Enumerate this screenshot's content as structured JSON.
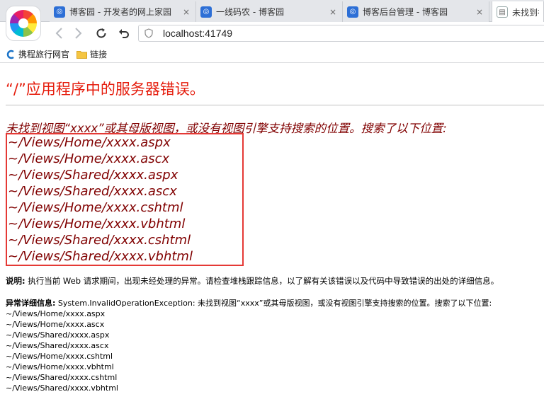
{
  "tabs": [
    {
      "title": "博客园 - 开发者的网上家园",
      "favicon": "cnblogs-icon",
      "active": false
    },
    {
      "title": "一线码农 - 博客园",
      "favicon": "cnblogs-icon",
      "active": false
    },
    {
      "title": "博客后台管理 - 博客园",
      "favicon": "cnblogs-icon",
      "active": false
    },
    {
      "title": "未找到视",
      "favicon": "page-icon",
      "active": true
    }
  ],
  "tab_close_glyph": "×",
  "address": {
    "url": "localhost:41749"
  },
  "bookmarks": [
    {
      "label": "携程旅行网官",
      "icon": "ctrip-icon"
    },
    {
      "label": "链接",
      "icon": "folder-icon"
    }
  ],
  "page": {
    "title": "“/”应用程序中的服务器错误。",
    "error_message": "未找到视图“xxxx”或其母版视图，或没有视图引擎支持搜索的位置。搜索了以下位置:",
    "locations": [
      "~/Views/Home/xxxx.aspx",
      "~/Views/Home/xxxx.ascx",
      "~/Views/Shared/xxxx.aspx",
      "~/Views/Shared/xxxx.ascx",
      "~/Views/Home/xxxx.cshtml",
      "~/Views/Home/xxxx.vbhtml",
      "~/Views/Shared/xxxx.cshtml",
      "~/Views/Shared/xxxx.vbhtml"
    ],
    "description_label": "说明:",
    "description_text": " 执行当前 Web 请求期间，出现未经处理的异常。请检查堆栈跟踪信息，以了解有关该错误以及代码中导致错误的出处的详细信息。",
    "details_label": "异常详细信息:",
    "details_text": " System.InvalidOperationException: 未找到视图“xxxx”或其母版视图，或没有视图引擎支持搜索的位置。搜索了以下位置:",
    "detail_locations": [
      "~/Views/Home/xxxx.aspx",
      "~/Views/Home/xxxx.ascx",
      "~/Views/Shared/xxxx.aspx",
      "~/Views/Shared/xxxx.ascx",
      "~/Views/Home/xxxx.cshtml",
      "~/Views/Home/xxxx.vbhtml",
      "~/Views/Shared/xxxx.cshtml",
      "~/Views/Shared/xxxx.vbhtml"
    ]
  },
  "colors": {
    "title_red": "#e51c0c",
    "message_maroon": "#800000",
    "highlight_box": "#e53935"
  }
}
